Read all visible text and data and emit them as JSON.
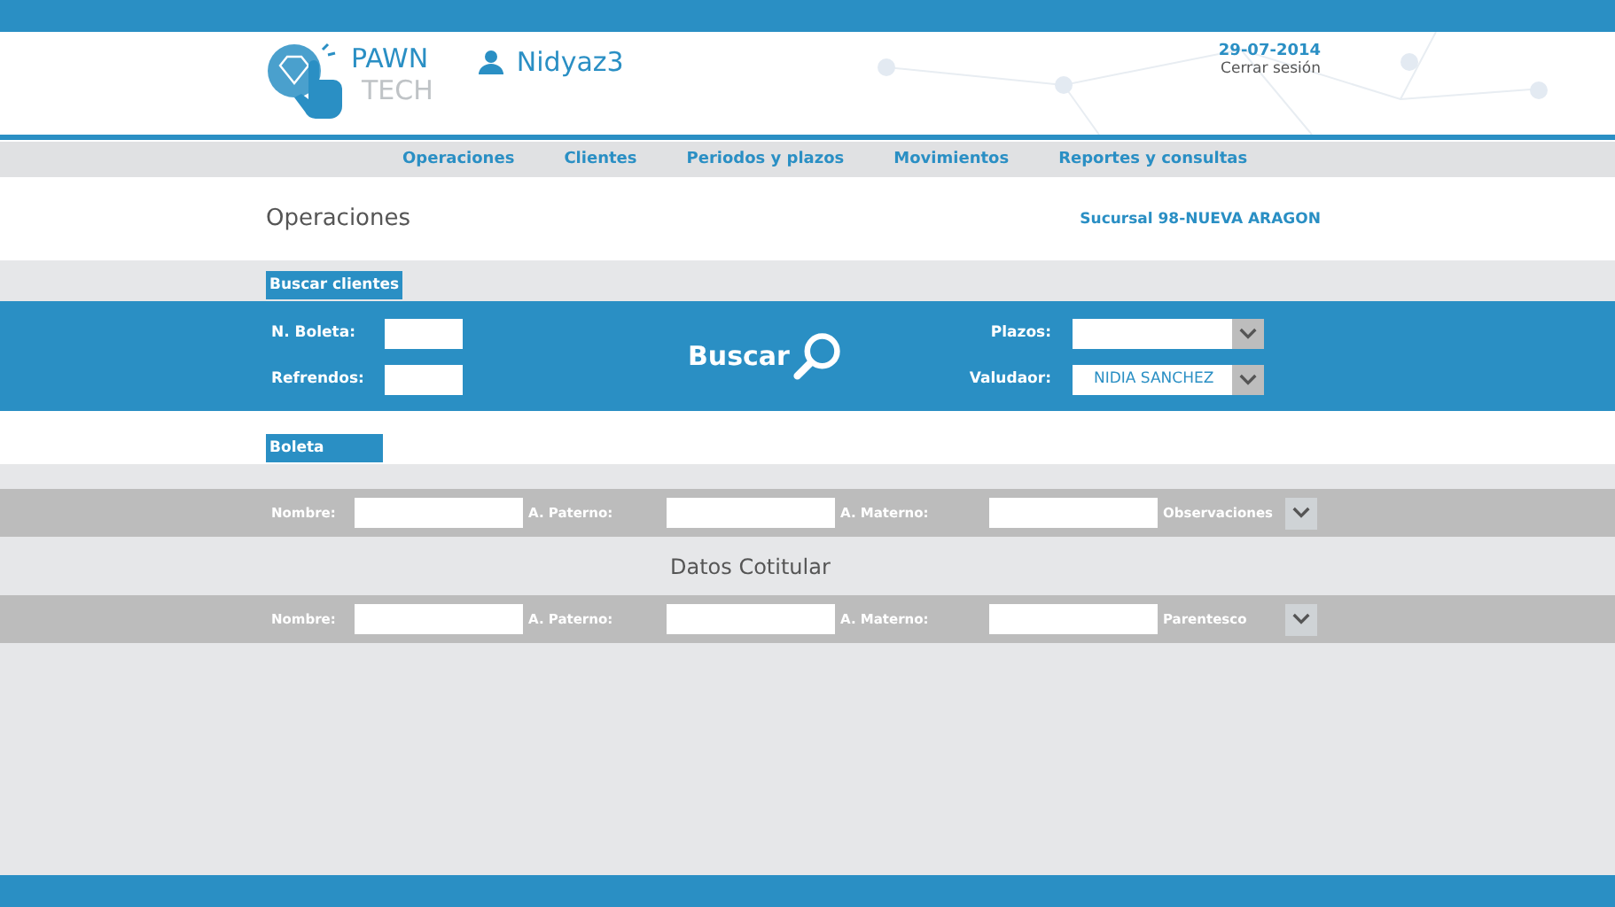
{
  "header": {
    "logo_top": "PAWN",
    "logo_bottom": "TECH",
    "user": "Nidyaz3",
    "date": "29-07-2014",
    "logout": "Cerrar sesión"
  },
  "nav": [
    {
      "label": "Operaciones"
    },
    {
      "label": "Clientes"
    },
    {
      "label": "Periodos y plazos"
    },
    {
      "label": "Movimientos"
    },
    {
      "label": "Reportes y consultas"
    }
  ],
  "page": {
    "title": "Operaciones",
    "branch": "Sucursal 98-NUEVA ARAGON"
  },
  "search": {
    "tab": "Buscar clientes",
    "fields": [
      {
        "label": "N. Boleta:"
      },
      {
        "label": "Refrendos:"
      }
    ],
    "button": "Buscar",
    "selects": [
      {
        "label": "Plazos:"
      },
      {
        "label": "Valudaor:",
        "value": "NIDIA SANCHEZ"
      }
    ]
  },
  "boleta": {
    "tab": "Boleta",
    "fields": [
      {
        "label": "Nombre:"
      },
      {
        "label": "A. Paterno:"
      },
      {
        "label": "A. Materno:"
      }
    ],
    "dropdown": "Observaciones"
  },
  "cotitular": {
    "title": "Datos Cotitular",
    "fields": [
      {
        "label": "Nombre:"
      },
      {
        "label": "A. Paterno:"
      },
      {
        "label": "A. Materno:"
      }
    ],
    "dropdown": "Parentesco"
  }
}
